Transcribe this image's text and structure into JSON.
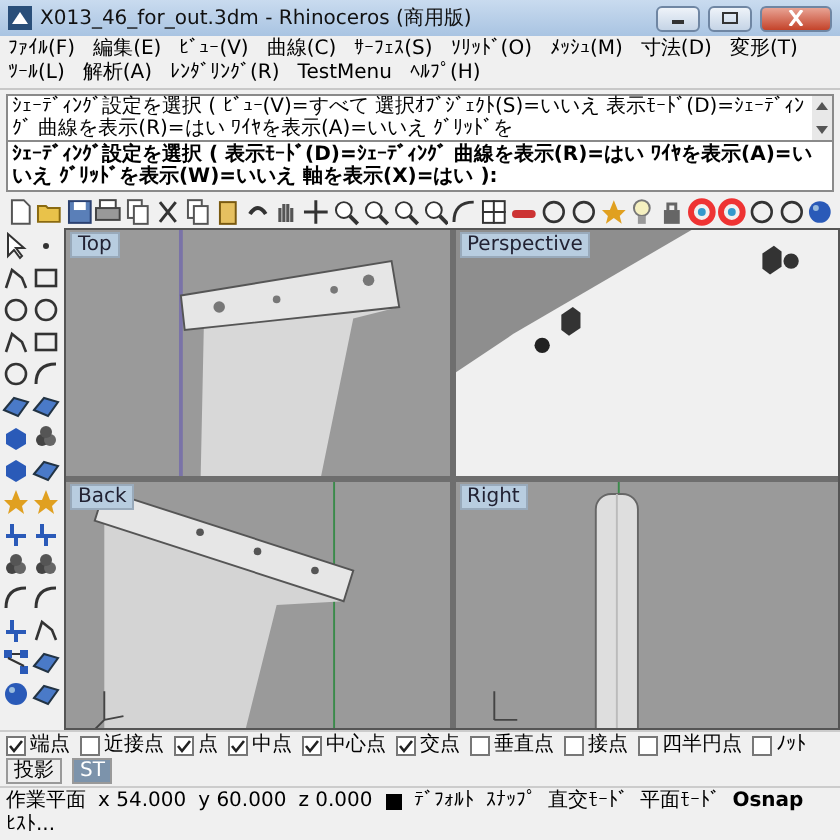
{
  "window": {
    "title": "X013_46_for_out.3dm - Rhinoceros (商用版)"
  },
  "menu": [
    "ﾌｧｲﾙ(F)",
    "編集(E)",
    "ﾋﾞｭｰ(V)",
    "曲線(C)",
    "ｻｰﾌｪｽ(S)",
    "ｿﾘｯﾄﾞ(O)",
    "ﾒｯｼｭ(M)",
    "寸法(D)",
    "変形(T)",
    "ﾂｰﾙ(L)",
    "解析(A)",
    "ﾚﾝﾀﾞﾘﾝｸﾞ(R)",
    "TestMenu",
    "ﾍﾙﾌﾟ(H)"
  ],
  "command": {
    "history": "ｼｪｰﾃﾞｨﾝｸﾞ設定を選択 ( ﾋﾞｭｰ(V)=すべて  選択ｵﾌﾞｼﾞｪｸﾄ(S)=いいえ  表示ﾓｰﾄﾞ(D)=ｼｪｰﾃﾞｨﾝｸﾞ  曲線を表示(R)=はい  ﾜｲﾔを表示(A)=いいえ  ｸﾞﾘｯﾄﾞを",
    "prompt": "ｼｪｰﾃﾞｨﾝｸﾞ設定を選択 ( 表示ﾓｰﾄﾞ(D)=ｼｪｰﾃﾞｨﾝｸﾞ  曲線を表示(R)=はい  ﾜｲﾔを表示(A)=いいえ  ｸﾞﾘｯﾄﾞを表示(W)=いいえ  軸を表示(X)=はい ):"
  },
  "viewports": [
    {
      "label": "Top"
    },
    {
      "label": "Perspective"
    },
    {
      "label": "Back"
    },
    {
      "label": "Right"
    }
  ],
  "osnap": [
    {
      "label": "端点",
      "checked": true
    },
    {
      "label": "近接点",
      "checked": false
    },
    {
      "label": "点",
      "checked": true
    },
    {
      "label": "中点",
      "checked": true
    },
    {
      "label": "中心点",
      "checked": true
    },
    {
      "label": "交点",
      "checked": true
    },
    {
      "label": "垂直点",
      "checked": false
    },
    {
      "label": "接点",
      "checked": false
    },
    {
      "label": "四半円点",
      "checked": false
    },
    {
      "label": "ﾉｯﾄ",
      "checked": false
    }
  ],
  "osnap_buttons": [
    "投影",
    "ST"
  ],
  "status_bar": {
    "plane": "作業平面",
    "x": "x 54.000",
    "y": "y 60.000",
    "z": "z 0.000",
    "layer": "ﾃﾞﾌｫﾙﾄ",
    "toggles": [
      "ｽﾅｯﾌﾟ",
      "直交ﾓｰﾄﾞ",
      "平面ﾓｰﾄﾞ",
      "Osnap",
      "ﾋｽﾄ..."
    ]
  }
}
